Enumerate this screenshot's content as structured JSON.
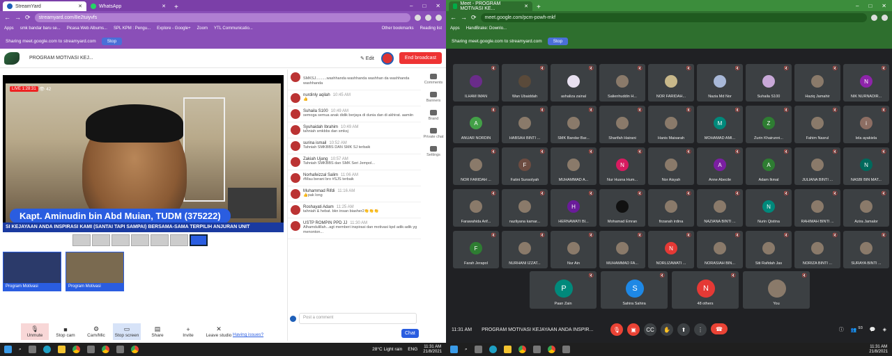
{
  "left_browser": {
    "tabs": [
      {
        "label": "StreamYard",
        "active": true
      },
      {
        "label": "WhatsApp",
        "active": false
      }
    ],
    "url": "streamyard.com/8e2tuiyvfs",
    "bookmarks": [
      "Apps",
      "smk bandar baru se...",
      "Picasa Web Albums...",
      "SPL KPM : Pengu...",
      "Explore - Google+",
      "Zoom",
      "YTL Communicatio...",
      "Other bookmarks",
      "Reading list"
    ],
    "sharing": "Sharing meet.google.com to streamyard.com",
    "stop": "Stop"
  },
  "streamyard": {
    "title": "PROGRAM MOTIVASI KEJ...",
    "edit": "Edit",
    "end_broadcast": "End broadcast",
    "live": "LIVE 1:28:31",
    "viewers": "42",
    "nameplate": "Kapt. Aminudin bin Abd Muian, TUDM (375222)",
    "ticker": "SI KEJAYAAN ANDA INSPIRASI KAMI (SANTAI TAPI SAMPAI) BERSAMA-SAMA TERPILIH ANJURAN UNIT",
    "thumbs": [
      "Program Motivasi",
      "Program Motivasi"
    ],
    "controls": [
      {
        "label": "Unmute",
        "icon": "mic-off-icon",
        "glyph": "🎙"
      },
      {
        "label": "Stop cam",
        "icon": "camera-icon",
        "glyph": "■"
      },
      {
        "label": "Cam/Mic",
        "icon": "settings-icon",
        "glyph": "⚙"
      },
      {
        "label": "Stop screen",
        "icon": "screen-icon",
        "glyph": "▭"
      },
      {
        "label": "Share",
        "icon": "share-icon",
        "glyph": "▤"
      },
      {
        "label": "Invite",
        "icon": "invite-icon",
        "glyph": "+"
      },
      {
        "label": "Leave studio",
        "icon": "leave-icon",
        "glyph": "✕"
      }
    ],
    "help": "Having issues?",
    "side": [
      "Comments",
      "Banners",
      "Brand",
      "Private chat",
      "Settings"
    ],
    "chat_placeholder": "Post a comment",
    "chat_button": "Chat"
  },
  "comments": [
    {
      "name": "",
      "time": "",
      "text": "SMKSJ..........washhanda washhanda washhan da washhanda washhanda"
    },
    {
      "name": "nurdinly aqilah",
      "time": "10:45 AM",
      "text": "👍"
    },
    {
      "name": "Suhaila S100",
      "time": "10:49 AM",
      "text": "semoga semua anak didik berjaya di dunia dan di akhirat. aamiin"
    },
    {
      "name": "Syuhaidah Ibrahim",
      "time": "10:49 AM",
      "text": "tahniah smkbbs dan smksj"
    },
    {
      "name": "surina ismail",
      "time": "10:52 AM",
      "text": "Tahniah SMKBBS DAN SMK SJ terbaik"
    },
    {
      "name": "Zakiah Ujang",
      "time": "10:57 AM",
      "text": "Tahniah SMKBBS dan SMK Seri Jempol..."
    },
    {
      "name": "Norhafeizzal Salim",
      "time": "11:06 AM",
      "text": "#Mau berani bro #SJS terbaik"
    },
    {
      "name": "Muhammad Rifdi",
      "time": "11:16 AM",
      "text": "👍pak long"
    },
    {
      "name": "Roshayati Adam",
      "time": "11:25 AM",
      "text": "tahniah & hebat. bkn insan biasher2👏👏👏"
    },
    {
      "name": "USTP ROMPIN PPD JJ",
      "time": "11:30 AM",
      "text": "Alhamdulillah...agt memberi inspirasi dan motivasi kpd adik-adik yg menonton..."
    }
  ],
  "right_browser": {
    "tab": "Meet - PROGRAM MOTIVASI KE...",
    "url": "meet.google.com/pcm-powh-mkf",
    "bookmarks": [
      "Apps",
      "HandBrake: Downlo..."
    ],
    "sharing": "Sharing meet.google.com to streamyard.com",
    "stop": "Stop"
  },
  "meet": {
    "tiles": [
      {
        "name": "ILHAM IMAN",
        "initial": "",
        "color": "#6a2c8a"
      },
      {
        "name": "Wan Ubaiddah",
        "initial": "",
        "color": "#5a4a3a"
      },
      {
        "name": "ashaliza zainal",
        "initial": "",
        "color": "#e8e0f0"
      },
      {
        "name": "Salienhuddin H...",
        "initial": "",
        "color": "#3c4043"
      },
      {
        "name": "NOR FARIDAH...",
        "initial": "",
        "color": "#c8b88a"
      },
      {
        "name": "Nazia Md Nor",
        "initial": "",
        "color": "#a8b8d8"
      },
      {
        "name": "Suhaila S100",
        "initial": "",
        "color": "#c8a8d8"
      },
      {
        "name": "Haziq Jamahir",
        "initial": "",
        "color": "#3c4043"
      },
      {
        "name": "NIK NURNADIR...",
        "initial": "N",
        "color": "#8e24aa"
      },
      {
        "name": "ANUAR NORDIN",
        "initial": "A",
        "color": "#43a047"
      },
      {
        "name": "HABSAH BINTI ...",
        "initial": "",
        "color": "#3c4043"
      },
      {
        "name": "SMK Bandar Bar...",
        "initial": "",
        "color": "#3c4043"
      },
      {
        "name": "Sharifah Hairani",
        "initial": "",
        "color": "#3c4043"
      },
      {
        "name": "Hanis Maisarah",
        "initial": "",
        "color": "#3c4043"
      },
      {
        "name": "MOHAMAD AMI...",
        "initial": "M",
        "color": "#00897b"
      },
      {
        "name": "Zurin Khairunni...",
        "initial": "Z",
        "color": "#2e7d32"
      },
      {
        "name": "Fahim Nasrul",
        "initial": "",
        "color": "#3c4043"
      },
      {
        "name": "lela ayakiela",
        "initial": "i",
        "color": "#8d6e63"
      },
      {
        "name": "NOR FARIDAH ...",
        "initial": "",
        "color": "#3c4043"
      },
      {
        "name": "Fatini Sunsolyah",
        "initial": "F",
        "color": "#6d4c41"
      },
      {
        "name": "MUHAMMAD A...",
        "initial": "",
        "color": "#3c4043"
      },
      {
        "name": "Nur Husna Hum...",
        "initial": "N",
        "color": "#d81b60"
      },
      {
        "name": "Nor Aisyah",
        "initial": "",
        "color": "#3c4043"
      },
      {
        "name": "Anne Abecile",
        "initial": "A",
        "color": "#7b1fa2"
      },
      {
        "name": "Adam Ikmal",
        "initial": "A",
        "color": "#2e7d32"
      },
      {
        "name": "JULIANA BINTI ...",
        "initial": "",
        "color": "#3c4043"
      },
      {
        "name": "NASBI BIN MAT...",
        "initial": "N",
        "color": "#00695c"
      },
      {
        "name": "Farawahida Arif...",
        "initial": "",
        "color": "#3c4043"
      },
      {
        "name": "nazliyana kamar...",
        "initial": "",
        "color": "#3c4043"
      },
      {
        "name": "HERNAWATI BI...",
        "initial": "H",
        "color": "#6a1b9a"
      },
      {
        "name": "Mohamad Emran",
        "initial": "",
        "color": "#111111"
      },
      {
        "name": "firzanah irdina",
        "initial": "",
        "color": "#3c4043"
      },
      {
        "name": "NAZIANA BINTI ...",
        "initial": "",
        "color": "#3c4043"
      },
      {
        "name": "Nurin Qistina",
        "initial": "N",
        "color": "#00897b"
      },
      {
        "name": "RAHIMAH BINTI ...",
        "initial": "",
        "color": "#3c4043"
      },
      {
        "name": "Azira Jamalor",
        "initial": "",
        "color": "#3c4043"
      },
      {
        "name": "Farah Jerapol",
        "initial": "F",
        "color": "#2e7d32"
      },
      {
        "name": "NURHANI IZZAT...",
        "initial": "",
        "color": "#3c4043"
      },
      {
        "name": "Nur Ain",
        "initial": "",
        "color": "#3c4043"
      },
      {
        "name": "MUHAMMAD FA...",
        "initial": "",
        "color": "#3c4043"
      },
      {
        "name": "NORLIZAWATI ...",
        "initial": "N",
        "color": "#e53935"
      },
      {
        "name": "NORASIAH BIN...",
        "initial": "",
        "color": "#3c4043"
      },
      {
        "name": "Siti Rafidah Jas",
        "initial": "",
        "color": "#3c4043"
      },
      {
        "name": "NORIZA BINTI ...",
        "initial": "",
        "color": "#3c4043"
      },
      {
        "name": "SURAYA BINTI ...",
        "initial": "",
        "color": "#3c4043"
      }
    ],
    "bottom_tiles": [
      {
        "name": "Paan Zain",
        "initial": "P",
        "color": "#00897b"
      },
      {
        "name": "Sahira Sahira",
        "initial": "S",
        "color": "#1e88e5"
      },
      {
        "name": "48 others",
        "initial": "N",
        "color": "#e53935"
      },
      {
        "name": "You",
        "initial": "",
        "color": "#3c4043"
      }
    ],
    "time": "11:31 AM",
    "title": "PROGRAM MOTIVASI KEJAYAAN ANDA INSPIR...",
    "participants_badge": "93"
  },
  "taskbar": {
    "weather": "28°C Light rain",
    "lang": "ENG",
    "time": "11:31 AM",
    "date": "21/8/2021"
  }
}
